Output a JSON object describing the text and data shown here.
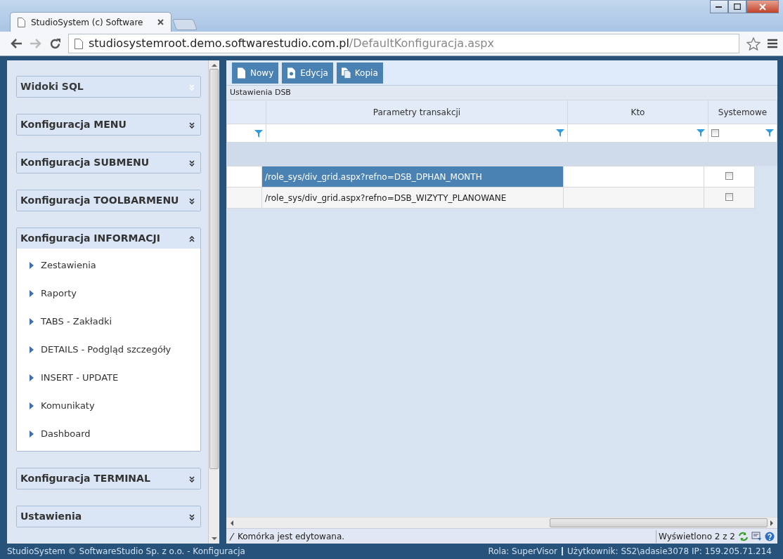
{
  "browser": {
    "tabs": [
      {
        "title": "StudioSystem (c) Software",
        "selected": true
      }
    ],
    "url": {
      "host": "studiosystemroot.demo.softwarestudio.com.pl",
      "path": "/DefaultKonfiguracja.aspx"
    }
  },
  "sidebar": {
    "sections": [
      {
        "title": "Widoki SQL",
        "expanded": false,
        "dim": true
      },
      {
        "title": "Konfiguracja MENU",
        "expanded": false
      },
      {
        "title": "Konfiguracja SUBMENU",
        "expanded": false
      },
      {
        "title": "Konfiguracja TOOLBARMENU",
        "expanded": false
      },
      {
        "title": "Konfiguracja INFORMACJI",
        "expanded": true,
        "items": [
          "Zestawienia",
          "Raporty",
          "TABS - Zakładki",
          "DETAILS - Podgląd szczegóły",
          "INSERT - UPDATE",
          "Komunikaty",
          "Dashboard"
        ]
      },
      {
        "title": "Konfiguracja TERMINAL",
        "expanded": false
      },
      {
        "title": "Ustawienia",
        "expanded": false
      }
    ]
  },
  "toolbar": {
    "buttons": [
      {
        "label": "Nowy",
        "kind": "new"
      },
      {
        "label": "Edycja",
        "kind": "edit"
      },
      {
        "label": "Kopia",
        "kind": "copy"
      }
    ]
  },
  "grid": {
    "caption": "Ustawienia DSB",
    "columns": [
      {
        "label": "Parametry transakcji",
        "kind": "text"
      },
      {
        "label": "Kto",
        "kind": "text"
      },
      {
        "label": "Systemowe",
        "kind": "checkbox",
        "filter_checked": false
      }
    ],
    "rows": [
      {
        "parametry": "/role_sys/div_grid.aspx?refno=DSB_DPHAN_MONTH",
        "kto": "",
        "systemowe": false,
        "selected": true
      },
      {
        "parametry": "/role_sys/div_grid.aspx?refno=DSB_WIZYTY_PLANOWANE",
        "kto": "",
        "systemowe": false,
        "selected": false
      }
    ]
  },
  "status_bar": {
    "message": "Komórka jest edytowana.",
    "count": "Wyświetlono 2 z 2"
  },
  "footer": {
    "left": "StudioSystem © SoftwareStudio Sp. z o.o. - Konfiguracja",
    "role": "Rola: SuperVisor",
    "user": "Użytkownik: SS2\\adasie3078 IP: 159.205.71.214"
  }
}
